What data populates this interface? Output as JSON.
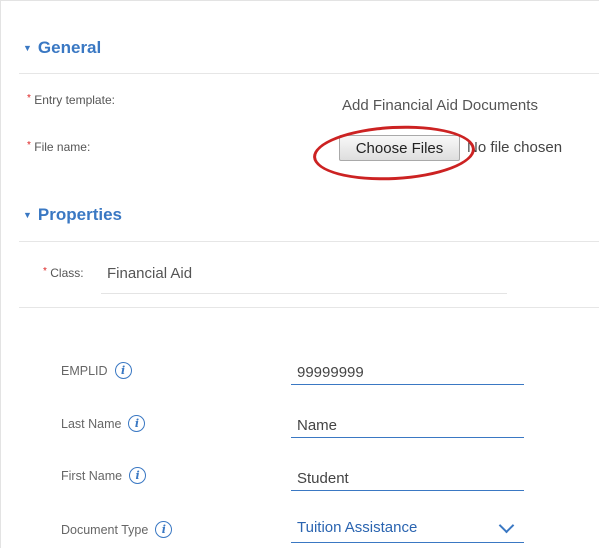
{
  "general": {
    "heading": "General",
    "entry_template_label": "Entry template:",
    "entry_template_value": "Add Financial Aid Documents",
    "file_name_label": "File name:",
    "choose_files_label": "Choose Files",
    "file_status": "No file chosen"
  },
  "properties": {
    "heading": "Properties",
    "class_label": "Class:",
    "class_value": "Financial Aid",
    "fields": [
      {
        "label": "EMPLID",
        "value": "99999999"
      },
      {
        "label": "Last Name",
        "value": "Name"
      },
      {
        "label": "First Name",
        "value": "Student"
      },
      {
        "label": "Document Type",
        "value": "Tuition Assistance"
      }
    ]
  },
  "required_marker": "*",
  "info_glyph": "i",
  "colors": {
    "accent": "#3a78c3",
    "required": "#dd2222",
    "highlight": "#cc2222"
  }
}
